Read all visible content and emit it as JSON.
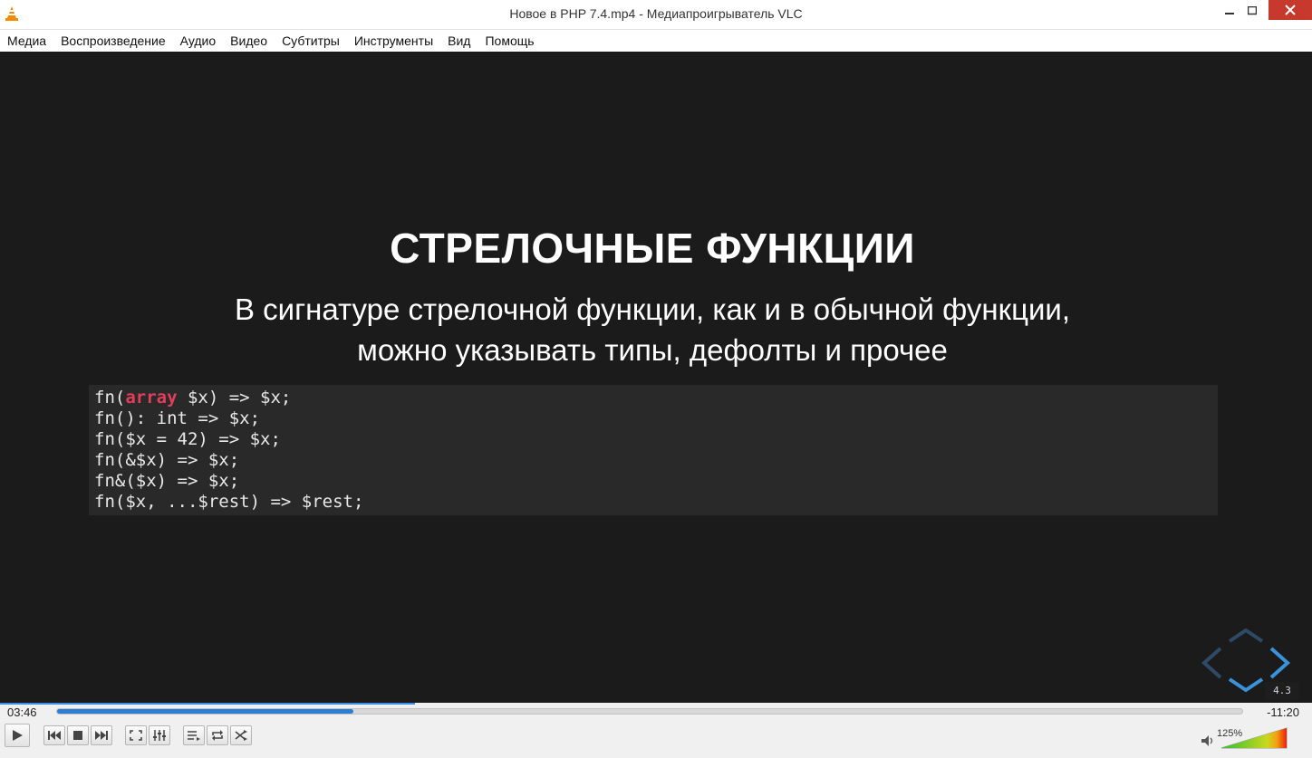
{
  "window": {
    "title": "Новое в PHP 7.4.mp4 - Медиапроигрыватель VLC",
    "close_color": "#c7392d"
  },
  "menu": {
    "items": [
      "Медиа",
      "Воспроизведение",
      "Аудио",
      "Видео",
      "Субтитры",
      "Инструменты",
      "Вид",
      "Помощь"
    ]
  },
  "slide": {
    "title": "СТРЕЛОЧНЫЕ ФУНКЦИИ",
    "subtitle_line1": "В сигнатуре стрелочной функции, как и в обычной функции,",
    "subtitle_line2": "можно указывать типы, дефолты и прочее",
    "code": {
      "line1_pre": "fn(",
      "line1_kw": "array",
      "line1_post": " $x) => $x;",
      "line2": "fn(): int => $x;",
      "line3": "fn($x = 42) => $x;",
      "line4": "fn(&$x) => $x;",
      "line5": "fn&($x) => $x;",
      "line6": "fn($x, ...$rest) => $rest;"
    },
    "badge": "4.3",
    "keyword_color": "#e03e5b"
  },
  "player": {
    "time_elapsed": "03:46",
    "time_remaining": "-11:20",
    "progress_fraction": 0.25,
    "volume_label": "125%",
    "volume_fraction": 1.0,
    "accent_color": "#2b7fd4",
    "icons": {
      "play": "play-icon",
      "prev": "skip-previous-icon",
      "stop": "stop-icon",
      "next": "skip-next-icon",
      "fullscreen": "fullscreen-icon",
      "extended": "equalizer-icon",
      "playlist": "playlist-icon",
      "loop": "loop-icon",
      "shuffle": "shuffle-icon",
      "volume": "speaker-icon"
    }
  }
}
